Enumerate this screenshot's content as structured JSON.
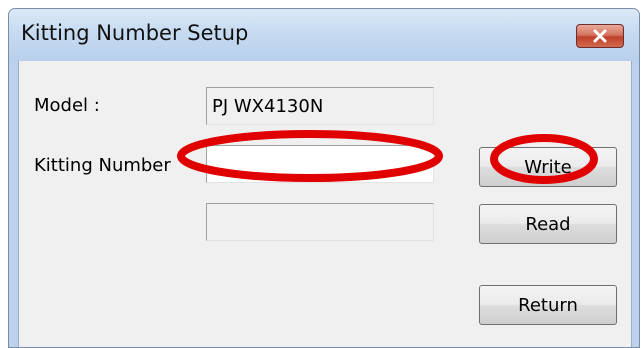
{
  "window": {
    "title": "Kitting Number Setup",
    "close_label": "close"
  },
  "form": {
    "model_label": "Model :",
    "model_value": "PJ WX4130N",
    "kitting_label": "Kitting Number",
    "kitting_value": "",
    "second_value": ""
  },
  "buttons": {
    "write": "Write",
    "read": "Read",
    "return": "Return"
  },
  "icons": {
    "close": "close-icon"
  },
  "colors": {
    "annotation": "#e00000",
    "close_button": "#c94a35"
  }
}
